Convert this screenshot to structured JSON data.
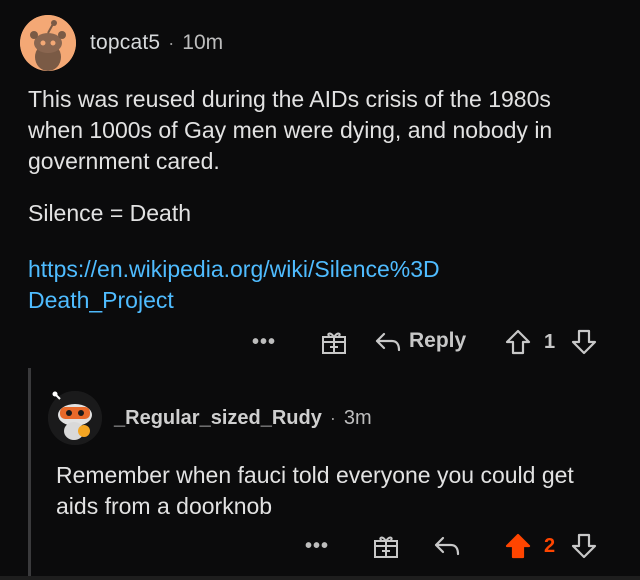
{
  "comments": [
    {
      "username": "topcat5",
      "separator": "·",
      "time": "10m",
      "body": "This was reused during the AIDs crisis of the 1980s when 1000s of Gay men were dying, and nobody in government cared.",
      "body2": "Silence = Death",
      "link": "https://en.wikipedia.org/wiki/Silence%3DDeath_Project",
      "actions": {
        "more": "•••",
        "award_icon": "gift-icon",
        "reply_label": "Reply",
        "vote_count": "1"
      }
    },
    {
      "username": "_Regular_sized_Rudy",
      "separator": "·",
      "time": "3m",
      "body": "Remember when fauci told everyone you could get aids from a doorknob",
      "actions": {
        "more": "•••",
        "award_icon": "gift-icon",
        "vote_count": "2",
        "upvoted": true
      }
    }
  ],
  "colors": {
    "background": "#0b0b0c",
    "link": "#4fbcff",
    "upvote_active": "#ff4500",
    "thread_line": "#3a3a3c"
  }
}
